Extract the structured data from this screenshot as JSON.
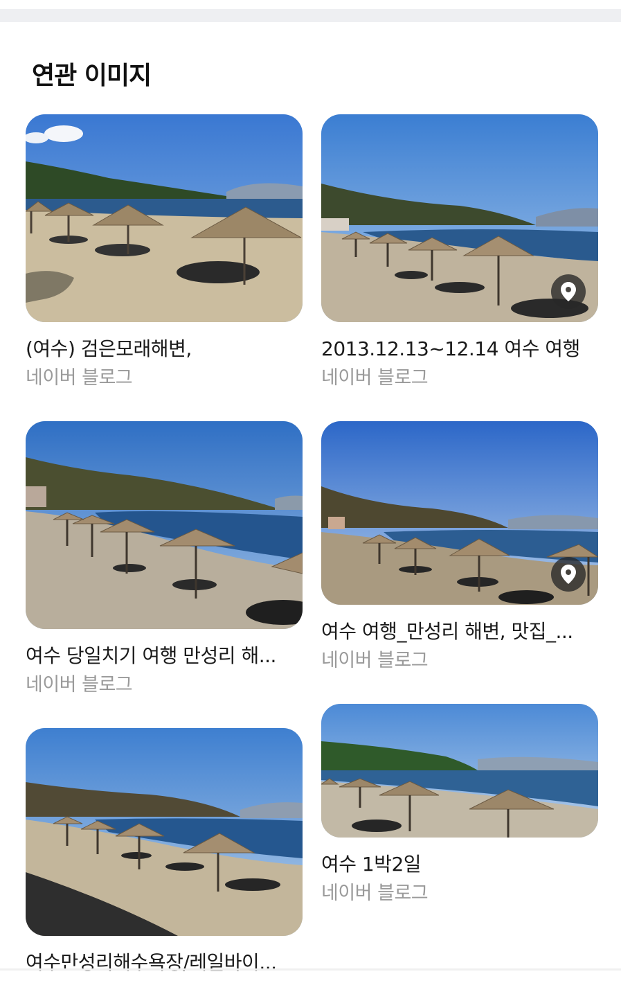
{
  "section": {
    "title": "연관 이미지"
  },
  "cards": [
    {
      "title": "(여수) 검은모래해변,",
      "source": "네이버 블로그",
      "has_location": false
    },
    {
      "title": "2013.12.13~12.14 여수 여행",
      "source": "네이버 블로그",
      "has_location": true
    },
    {
      "title": "여수 당일치기 여행 만성리 해...",
      "source": "네이버 블로그",
      "has_location": false
    },
    {
      "title": "여수 여행_만성리 해변, 맛집_...",
      "source": "네이버 블로그",
      "has_location": true
    },
    {
      "title": "여수만성리해수욕장/레일바이...",
      "source": "",
      "has_location": false
    },
    {
      "title": "여수 1박2일",
      "source": "네이버 블로그",
      "has_location": false
    }
  ],
  "icons": {
    "location": "map-pin-icon"
  },
  "colors": {
    "sky": "#4a86d0",
    "sea": "#2f5f96",
    "sand": "#c8b89c",
    "hill": "#3c5a2e"
  }
}
